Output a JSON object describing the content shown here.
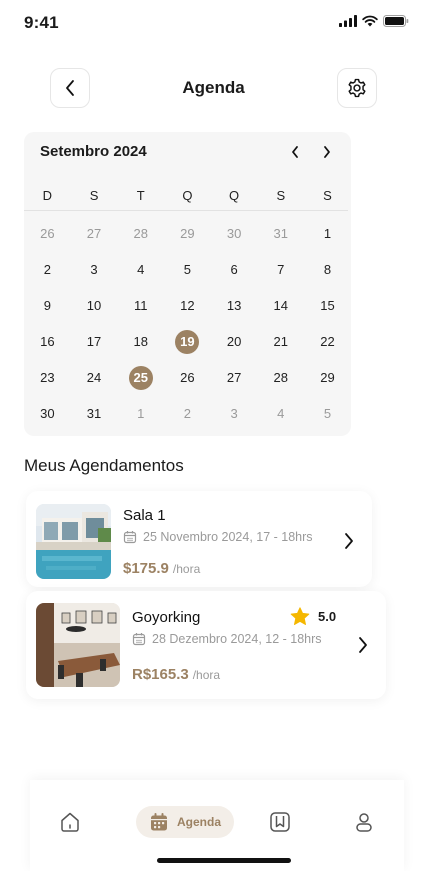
{
  "status_bar": {
    "time": "9:41"
  },
  "header": {
    "title": "Agenda"
  },
  "calendar": {
    "month_label": "Setembro 2024",
    "weekdays": [
      "D",
      "S",
      "T",
      "Q",
      "Q",
      "S",
      "S"
    ],
    "weeks": [
      [
        {
          "d": "26",
          "m": true
        },
        {
          "d": "27",
          "m": true
        },
        {
          "d": "28",
          "m": true
        },
        {
          "d": "29",
          "m": true
        },
        {
          "d": "30",
          "m": true
        },
        {
          "d": "31",
          "m": true
        },
        {
          "d": "1"
        }
      ],
      [
        {
          "d": "2"
        },
        {
          "d": "3"
        },
        {
          "d": "4"
        },
        {
          "d": "5"
        },
        {
          "d": "6"
        },
        {
          "d": "7"
        },
        {
          "d": "8"
        }
      ],
      [
        {
          "d": "9"
        },
        {
          "d": "10"
        },
        {
          "d": "11"
        },
        {
          "d": "12"
        },
        {
          "d": "13"
        },
        {
          "d": "14"
        },
        {
          "d": "15"
        }
      ],
      [
        {
          "d": "16"
        },
        {
          "d": "17"
        },
        {
          "d": "18"
        },
        {
          "d": "19",
          "s": true
        },
        {
          "d": "20"
        },
        {
          "d": "21"
        },
        {
          "d": "22"
        }
      ],
      [
        {
          "d": "23"
        },
        {
          "d": "24"
        },
        {
          "d": "25",
          "s": true
        },
        {
          "d": "26"
        },
        {
          "d": "27"
        },
        {
          "d": "28"
        },
        {
          "d": "29"
        }
      ],
      [
        {
          "d": "30"
        },
        {
          "d": "31"
        },
        {
          "d": "1",
          "m": true
        },
        {
          "d": "2",
          "m": true
        },
        {
          "d": "3",
          "m": true
        },
        {
          "d": "4",
          "m": true
        },
        {
          "d": "5",
          "m": true
        }
      ]
    ]
  },
  "appointments": {
    "section_title": "Meus Agendamentos",
    "items": [
      {
        "name": "Sala 1",
        "date": "25 Novembro 2024, 17 - 18hrs",
        "price": "$175.9",
        "unit": "/hora"
      },
      {
        "name": "Goyorking",
        "date": "28 Dezembro 2024, 12 - 18hrs",
        "price": "R$165.3",
        "unit": "/hora",
        "rating": "5.0"
      }
    ]
  },
  "bottom_nav": {
    "items": [
      {
        "icon": "home-icon"
      },
      {
        "icon": "calendar-icon",
        "label": "Agenda",
        "active": true
      },
      {
        "icon": "bookmark-icon"
      },
      {
        "icon": "user-icon"
      }
    ]
  },
  "colors": {
    "accent": "#9c8263",
    "accent_soft": "#f3eee8",
    "calendar_bg": "#f6f6f6",
    "star": "#f5b700"
  }
}
